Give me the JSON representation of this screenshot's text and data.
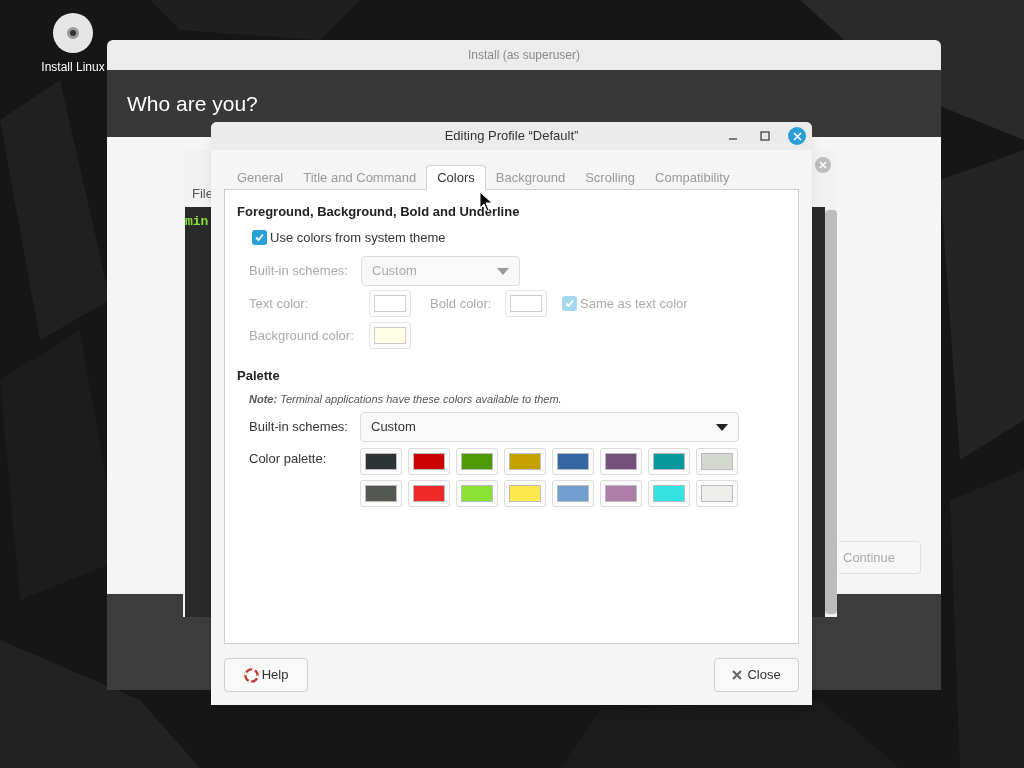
{
  "desktop": {
    "icons": [
      {
        "label": "Install Linux"
      }
    ]
  },
  "installer": {
    "title": "Install (as superuser)",
    "heading": "Who are you?",
    "continue_button": {
      "label": "Continue",
      "disabled": true
    }
  },
  "terminal": {
    "menu": [
      "File"
    ],
    "prompt": "min"
  },
  "dialog": {
    "title": "Editing Profile “Default”",
    "tabs": [
      {
        "label": "General",
        "selected": false
      },
      {
        "label": "Title and Command",
        "selected": false
      },
      {
        "label": "Colors",
        "selected": true
      },
      {
        "label": "Background",
        "selected": false
      },
      {
        "label": "Scrolling",
        "selected": false
      },
      {
        "label": "Compatibility",
        "selected": false
      }
    ],
    "foreground_section": {
      "heading": "Foreground, Background, Bold and Underline",
      "use_system_colors": {
        "label": "Use colors from system theme",
        "checked": true
      },
      "builtin_schemes": {
        "label": "Built-in schemes:",
        "value": "Custom",
        "disabled": true
      },
      "text_color": {
        "label": "Text color:",
        "color": "#ffffff",
        "disabled": true
      },
      "bold_color": {
        "label": "Bold color:",
        "color": "#ffffff",
        "disabled": true
      },
      "same_as_text": {
        "label": "Same as text color",
        "checked": true,
        "disabled": true
      },
      "background_color": {
        "label": "Background color:",
        "color": "#ffffdd",
        "disabled": true
      }
    },
    "palette_section": {
      "heading": "Palette",
      "note": "**Note:** Terminal applications have these colors available to them.",
      "builtin_schemes": {
        "label": "Built-in schemes:",
        "value": "Custom",
        "disabled": false
      },
      "palette_label": "Color palette:",
      "colors": [
        {
          "color": "#2e3436"
        },
        {
          "color": "#cc0000"
        },
        {
          "color": "#4e9a06"
        },
        {
          "color": "#c4a000"
        },
        {
          "color": "#3465a4"
        },
        {
          "color": "#75507b"
        },
        {
          "color": "#06989a"
        },
        {
          "color": "#d3d7cf"
        },
        {
          "color": "#555753"
        },
        {
          "color": "#ef2929"
        },
        {
          "color": "#8ae234"
        },
        {
          "color": "#fce94f"
        },
        {
          "color": "#729fcf"
        },
        {
          "color": "#ad7fa8"
        },
        {
          "color": "#34e2e2"
        },
        {
          "color": "#eeeeec"
        }
      ]
    },
    "help_button": "Help",
    "close_button": "Close"
  }
}
